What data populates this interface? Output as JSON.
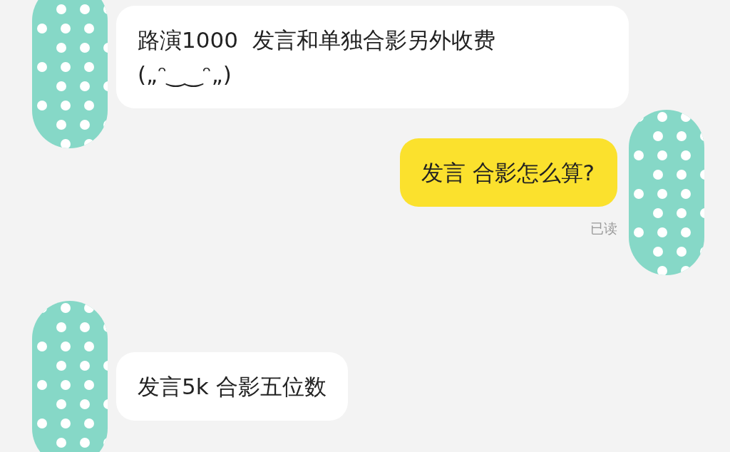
{
  "messages": [
    {
      "kind": "incoming",
      "text": "路演1000  发言和单独合影另外收费\n(„ᵔ‿‿ᵔ„)"
    },
    {
      "kind": "outgoing",
      "text": "发言 合影怎么算?",
      "receipt": "已读"
    },
    {
      "kind": "incoming",
      "text": "发言5k 合影五位数"
    }
  ]
}
